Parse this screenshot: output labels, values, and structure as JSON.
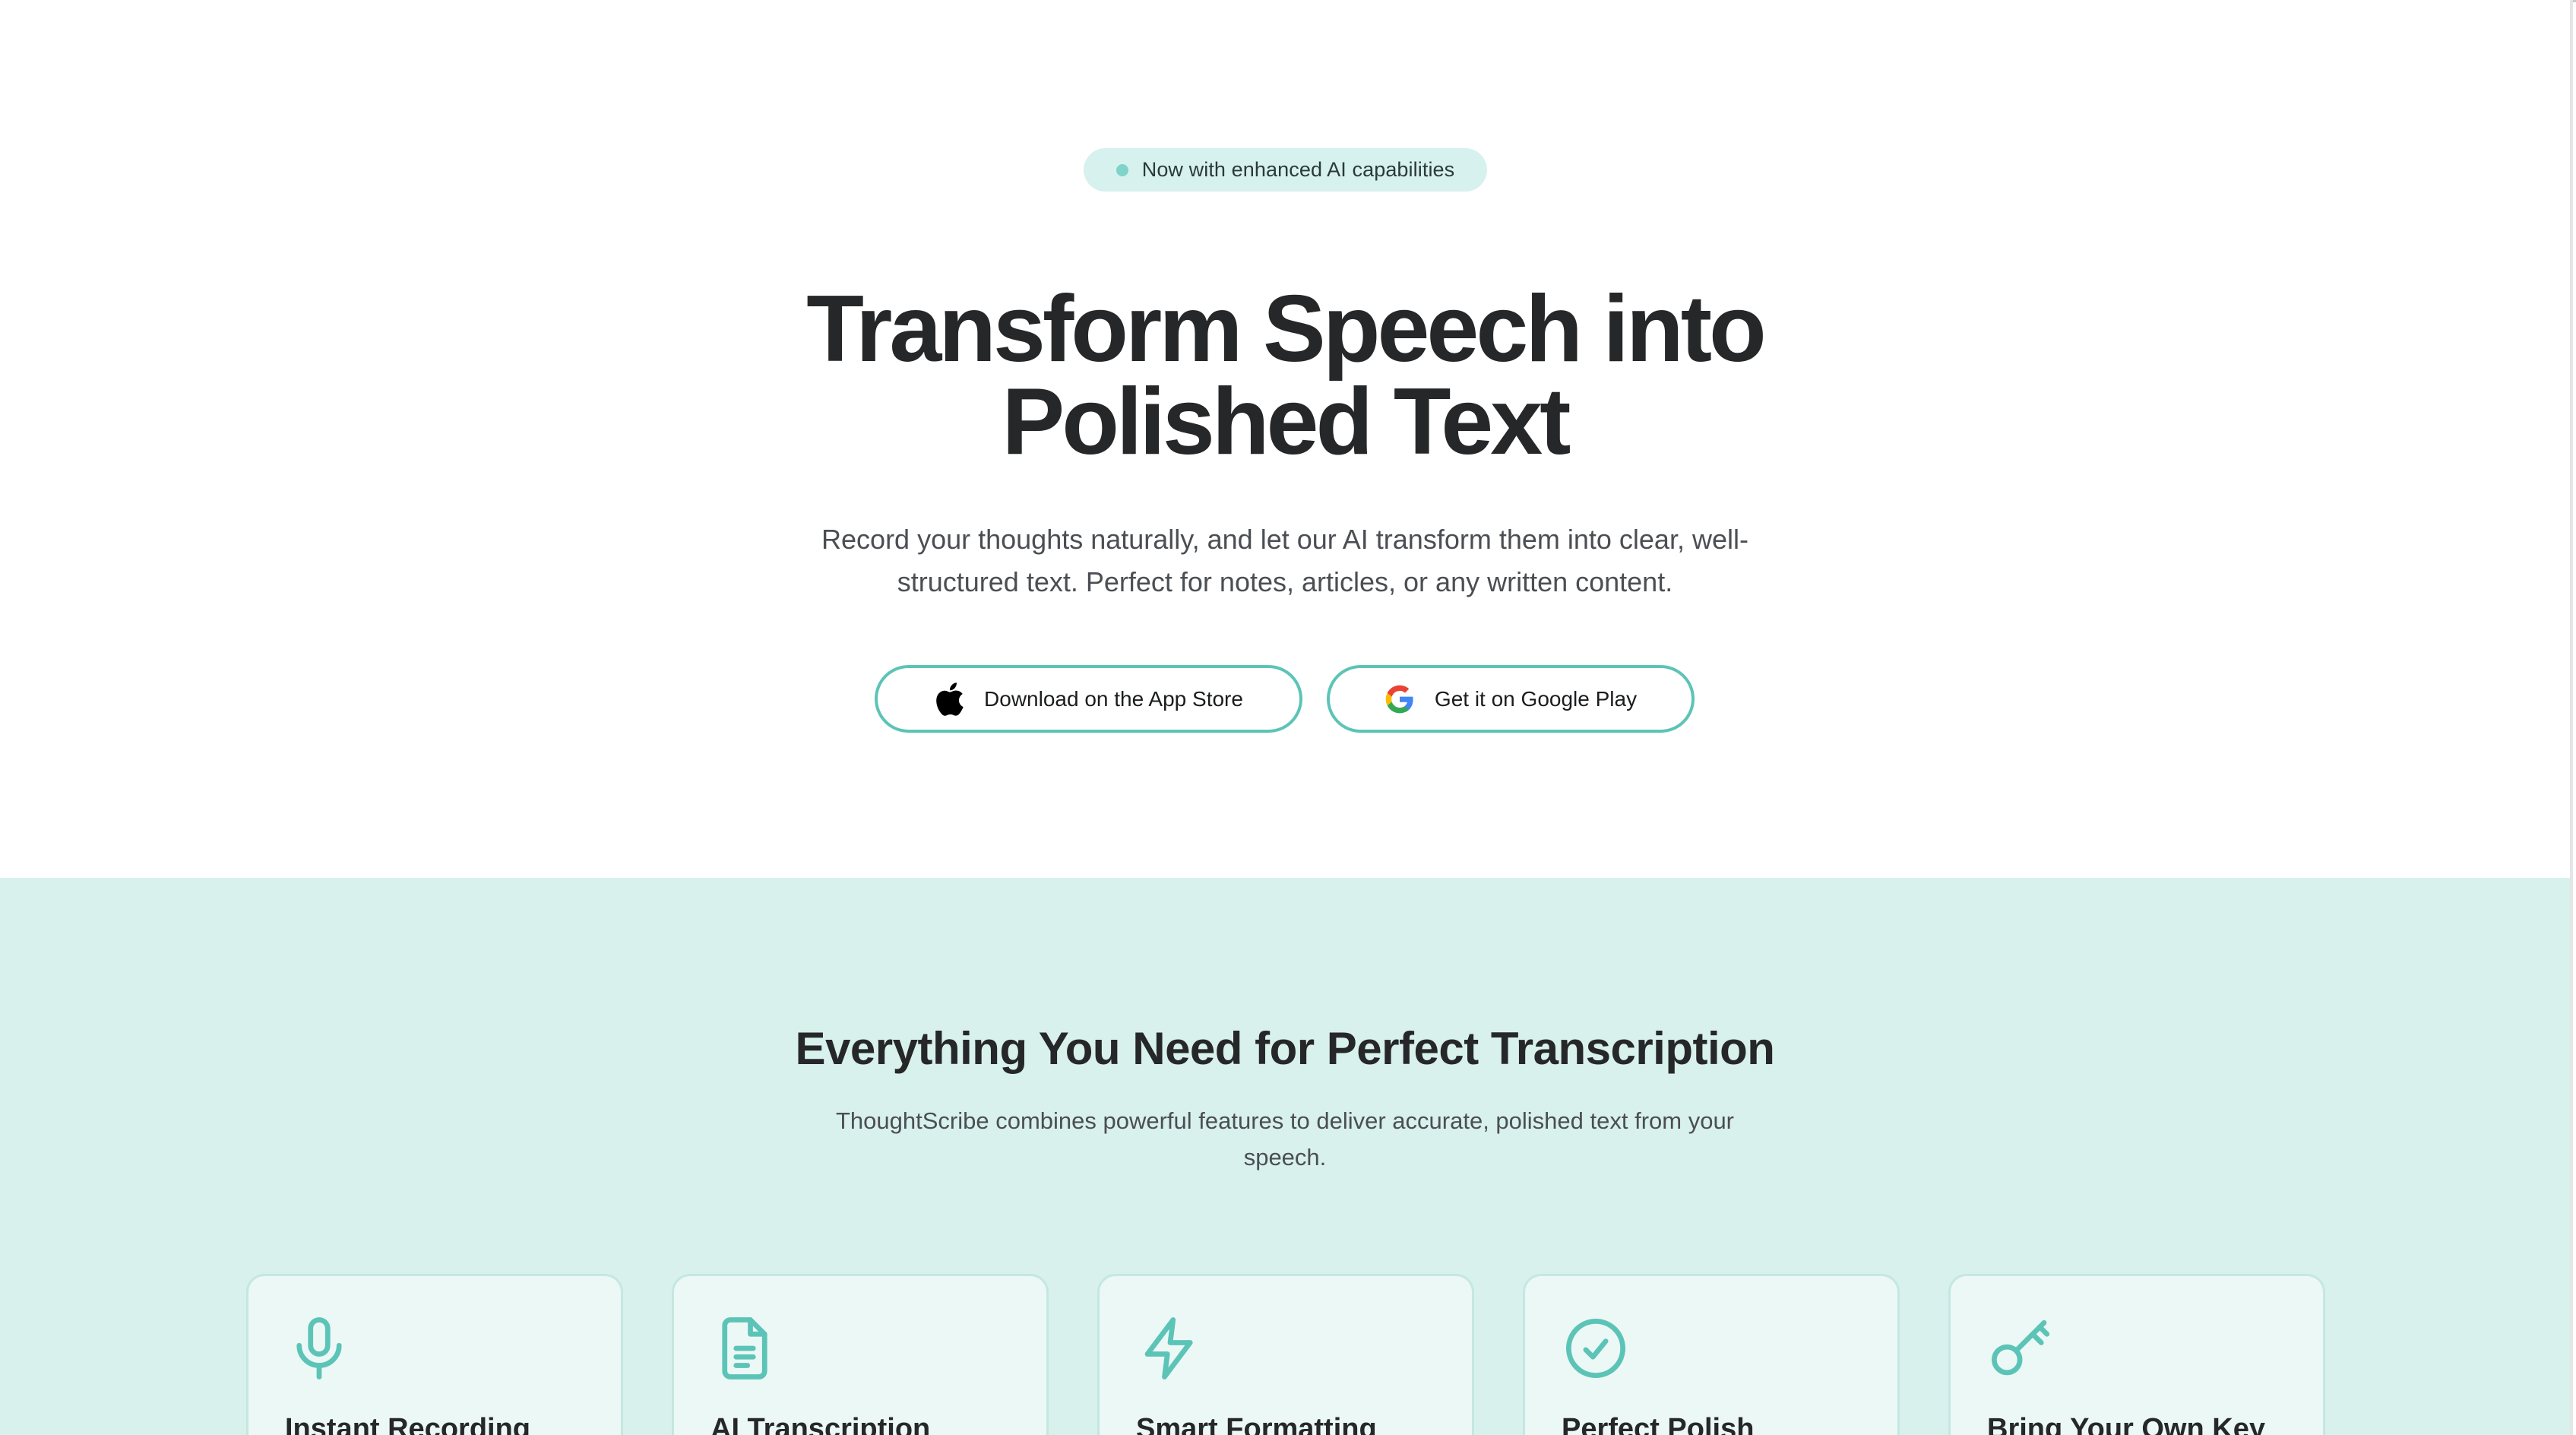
{
  "hero": {
    "badge": "Now with enhanced AI capabilities",
    "title_line1": "Transform Speech into",
    "title_line2": "Polished Text",
    "subtitle_line1": "Record your thoughts naturally, and let our AI transform them into clear, well-",
    "subtitle_line2": "structured text. Perfect for notes, articles, or any written content.",
    "app_store_label": "Download on the App Store",
    "google_play_label": "Get it on Google Play"
  },
  "features": {
    "title": "Everything You Need for Perfect Transcription",
    "subtitle_line1": "ThoughtScribe combines powerful features to deliver accurate, polished text from your",
    "subtitle_line2": "speech.",
    "cards": [
      {
        "icon": "microphone-icon",
        "title": "Instant Recording"
      },
      {
        "icon": "document-icon",
        "title": "AI Transcription"
      },
      {
        "icon": "lightning-icon",
        "title": "Smart Formatting"
      },
      {
        "icon": "check-circle-icon",
        "title": "Perfect Polish"
      },
      {
        "icon": "key-icon",
        "title": "Bring Your Own Key"
      }
    ]
  },
  "colors": {
    "accent": "#5cc4b7",
    "features_background": "#d8f1ed",
    "badge_background": "#d7f1ee",
    "heading_text": "#262728"
  }
}
